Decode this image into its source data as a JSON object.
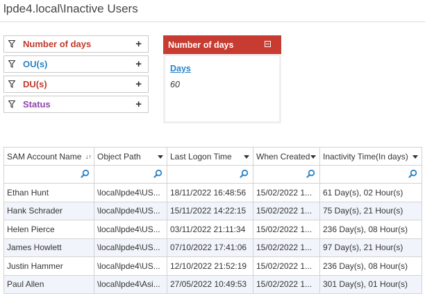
{
  "header": {
    "title": "lpde4.local\\Inactive Users"
  },
  "filters": [
    {
      "label": "Number of days",
      "color": "#c0392b"
    },
    {
      "label": "OU(s)",
      "color": "#2a84c6"
    },
    {
      "label": "DU(s)",
      "color": "#c0392b"
    },
    {
      "label": "Status",
      "color": "#8e44ad"
    }
  ],
  "panel": {
    "title": "Number of days",
    "link": "Days",
    "value": "60"
  },
  "table": {
    "columns": [
      "SAM Account Name",
      "Object Path",
      "Last Logon Time",
      "When Created",
      "Inactivity Time(In days)"
    ],
    "rows": [
      [
        "Ethan Hunt",
        "\\local\\lpde4\\US...",
        "18/11/2022 16:48:56",
        "15/02/2022 1...",
        "61 Day(s), 02 Hour(s)"
      ],
      [
        "Hank Schrader",
        "\\local\\lpde4\\US...",
        "15/11/2022 14:22:15",
        "15/02/2022 1...",
        "75 Day(s), 21 Hour(s)"
      ],
      [
        "Helen Pierce",
        "\\local\\lpde4\\US...",
        "03/11/2022 21:11:34",
        "15/02/2022 1...",
        "236 Day(s), 08 Hour(s)"
      ],
      [
        "James Howlett",
        "\\local\\lpde4\\US...",
        "07/10/2022 17:41:06",
        "15/02/2022 1...",
        "97 Day(s), 21 Hour(s)"
      ],
      [
        "Justin Hammer",
        "\\local\\lpde4\\US...",
        "12/10/2022 21:52:19",
        "15/02/2022 1...",
        "236 Day(s), 08 Hour(s)"
      ],
      [
        "Paul Allen",
        "\\local\\lpde4\\Asi...",
        "27/05/2022 10:49:53",
        "15/02/2022 1...",
        "301 Day(s), 01 Hour(s)"
      ]
    ]
  },
  "icons": {
    "filter": "funnel-icon",
    "add": "plus-icon",
    "search": "search-icon",
    "collapse": "collapse-icon"
  }
}
